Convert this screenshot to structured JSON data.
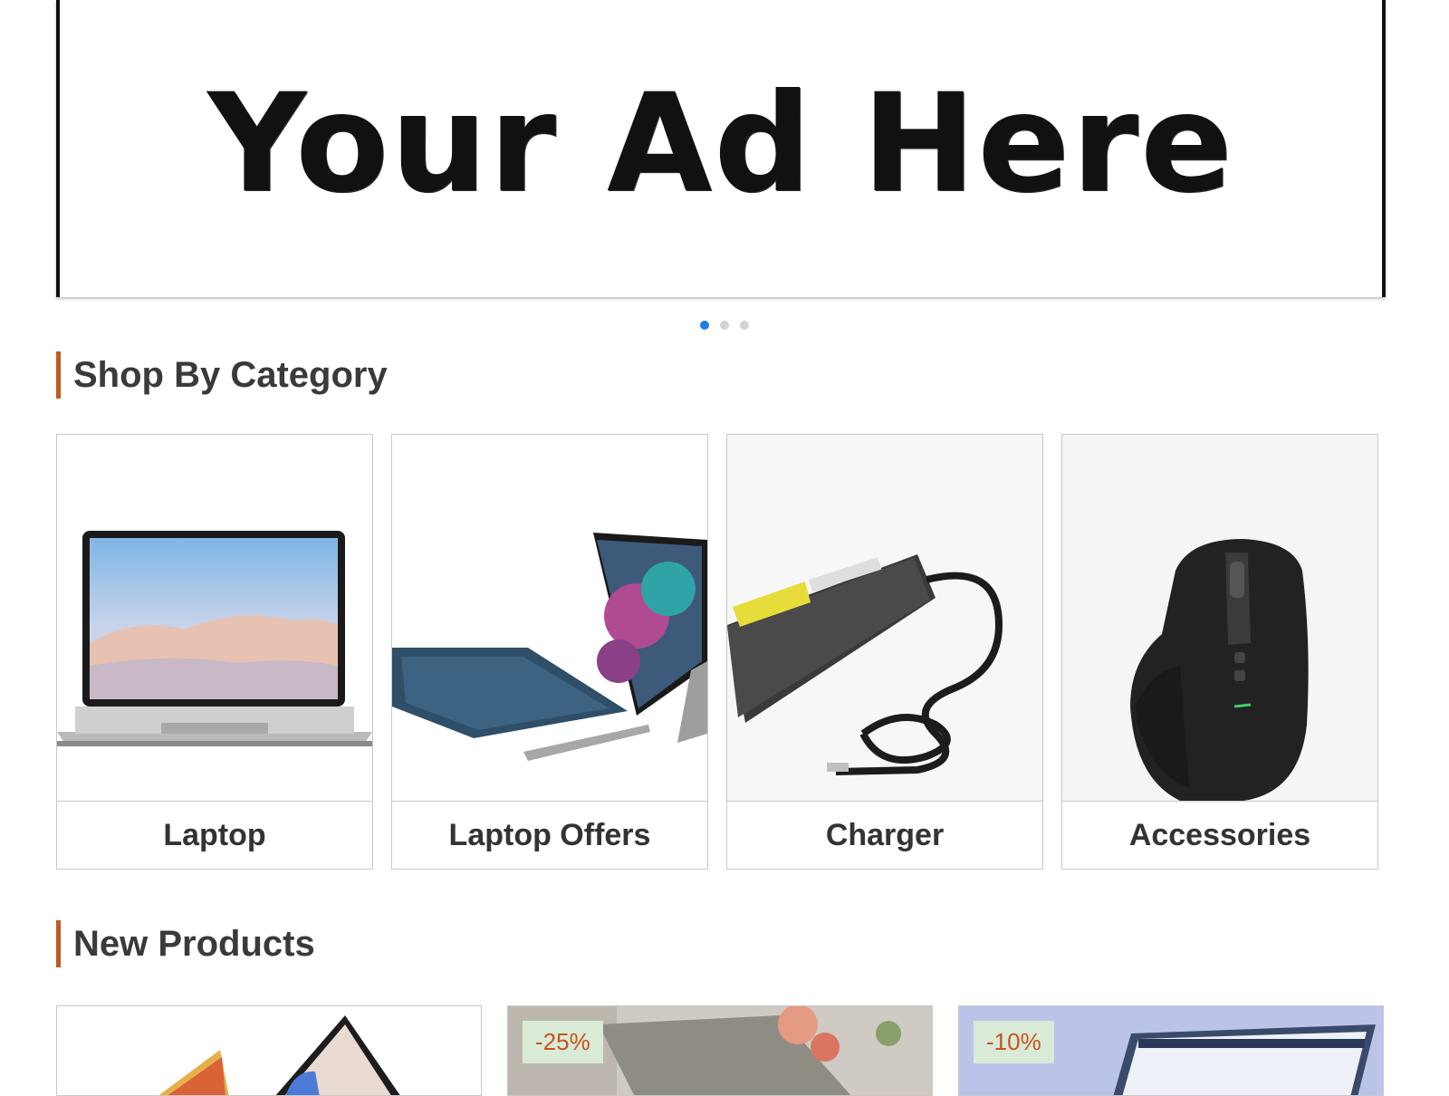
{
  "banner": {
    "text": "Your Ad Here"
  },
  "carousel": {
    "total": 3,
    "active": 1
  },
  "sections": {
    "category_title": "Shop By Category",
    "new_products_title": "New Products"
  },
  "categories": [
    {
      "label": "Laptop"
    },
    {
      "label": "Laptop Offers"
    },
    {
      "label": "Charger"
    },
    {
      "label": "Accessories"
    }
  ],
  "products": [
    {
      "badge": ""
    },
    {
      "badge": "-25%"
    },
    {
      "badge": "-10%"
    }
  ],
  "colors": {
    "accent": "#c15a22",
    "dot_active": "#1e7be0",
    "badge_bg": "#d9ead6",
    "badge_text": "#c6541e"
  }
}
